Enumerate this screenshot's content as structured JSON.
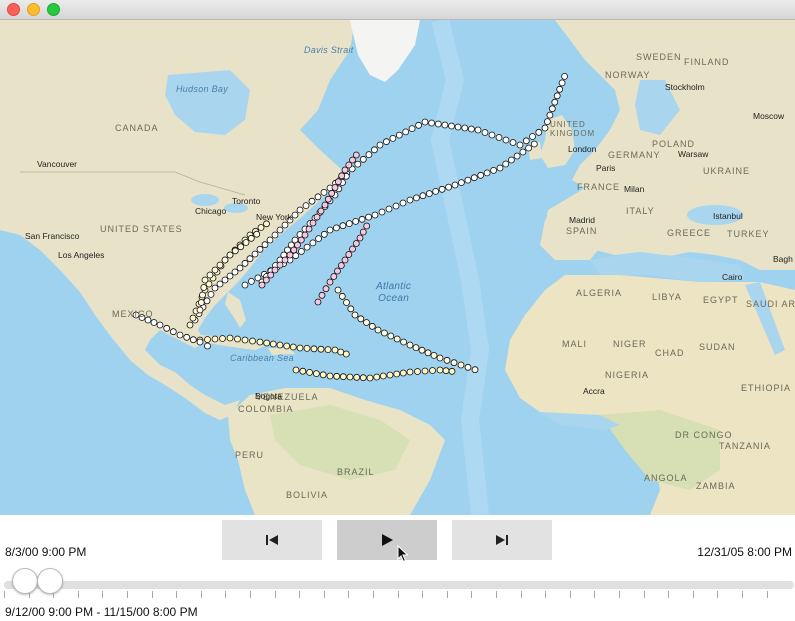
{
  "window": {
    "controls": [
      "close",
      "minimize",
      "maximize"
    ]
  },
  "map": {
    "labels": {
      "countries": [
        {
          "name": "CANADA"
        },
        {
          "name": "UNITED STATES"
        },
        {
          "name": "MEXICO"
        },
        {
          "name": "VENEZUELA"
        },
        {
          "name": "COLOMBIA"
        },
        {
          "name": "PERU"
        },
        {
          "name": "BRAZIL"
        },
        {
          "name": "BOLIVIA"
        },
        {
          "name": "SWEDEN"
        },
        {
          "name": "FINLAND"
        },
        {
          "name": "NORWAY"
        },
        {
          "name": "UNITED KINGDOM"
        },
        {
          "name": "GERMANY"
        },
        {
          "name": "POLAND"
        },
        {
          "name": "UKRAINE"
        },
        {
          "name": "FRANCE"
        },
        {
          "name": "ITALY"
        },
        {
          "name": "SPAIN"
        },
        {
          "name": "GREECE"
        },
        {
          "name": "TURKEY"
        },
        {
          "name": "ALGERIA"
        },
        {
          "name": "LIBYA"
        },
        {
          "name": "EGYPT"
        },
        {
          "name": "SAUDI ARAB"
        },
        {
          "name": "MALI"
        },
        {
          "name": "NIGER"
        },
        {
          "name": "CHAD"
        },
        {
          "name": "SUDAN"
        },
        {
          "name": "NIGERIA"
        },
        {
          "name": "ETHIOPIA"
        },
        {
          "name": "DR CONGO"
        },
        {
          "name": "TANZANIA"
        },
        {
          "name": "ANGOLA"
        },
        {
          "name": "ZAMBIA"
        }
      ],
      "cities": [
        "Vancouver",
        "San Francisco",
        "Los Angeles",
        "Chicago",
        "Toronto",
        "New York",
        "Bogota",
        "Stockholm",
        "Moscow",
        "London",
        "Paris",
        "Warsaw",
        "Milan",
        "Madrid",
        "Istanbul",
        "Cairo",
        "Accra",
        "Bagh"
      ],
      "water": [
        "Davis Strait",
        "Hudson Bay",
        "Caribbean Sea"
      ],
      "ocean": [
        "Atlantic",
        "Ocean"
      ]
    }
  },
  "controls": {
    "first_button": "skip-to-start",
    "play_button": "play",
    "last_button": "skip-to-end",
    "start_date": "8/3/00 9:00 PM",
    "end_date": "12/31/05 8:00 PM",
    "time_extent": "9/12/00 9:00 PM - 11/15/00 8:00 PM"
  }
}
